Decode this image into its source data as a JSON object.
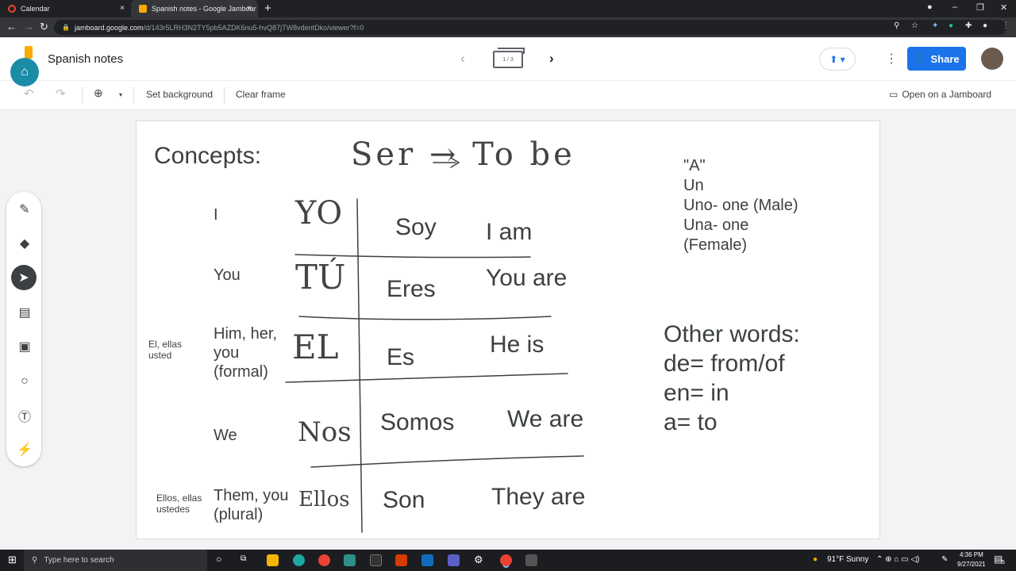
{
  "browser": {
    "tabs": [
      {
        "title": "Calendar",
        "close": "×"
      },
      {
        "title": "Spanish notes - Google Jamboar",
        "close": "×"
      }
    ],
    "new_tab": "+",
    "window_controls": [
      "–",
      "❐",
      "✕"
    ],
    "url_host": "jamboard.google.com",
    "url_path": "/d/143r5LRH3N2TY5pb5AZDK6nu5-hvQ87jTW8vdentDko/viewer?f=0"
  },
  "app": {
    "doc_title": "Spanish notes",
    "frame_indicator": "1 / 3",
    "prev": "‹",
    "next": "›",
    "share_label": "Share",
    "more": "⋮"
  },
  "toolbar": {
    "set_background": "Set background",
    "clear_frame": "Clear frame",
    "open_on_jamboard": "Open on a Jamboard"
  },
  "board": {
    "concepts": "Concepts:",
    "ser": "Ser → To be",
    "rows": [
      {
        "side": "",
        "english": "I",
        "hand": "YO",
        "spanish": "Soy",
        "translation": "I am"
      },
      {
        "side": "",
        "english": "You",
        "hand": "TÚ",
        "spanish": "Eres",
        "translation": "You are"
      },
      {
        "side": "El, ellas\nusted",
        "english": "Him, her,\nyou\n(formal)",
        "hand": "EL",
        "spanish": "Es",
        "translation": "He is"
      },
      {
        "side": "",
        "english": "We",
        "hand": "Nos",
        "spanish": "Somos",
        "translation": "We are"
      },
      {
        "side": "Ellos, ellas\nustedes",
        "english": "Them, you\n(plural)",
        "hand": "Ellos",
        "spanish": "Son",
        "translation": "They are"
      }
    ],
    "article_note": "\"A\"\nUn\nUno- one (Male)\nUna- one\n(Female)",
    "other_words": "Other words:\nde= from/of\nen= in\na= to"
  },
  "taskbar": {
    "search_placeholder": "Type here to search",
    "weather": "91°F  Sunny",
    "time": "4:36 PM",
    "date": "9/27/2021",
    "badge": "5"
  }
}
